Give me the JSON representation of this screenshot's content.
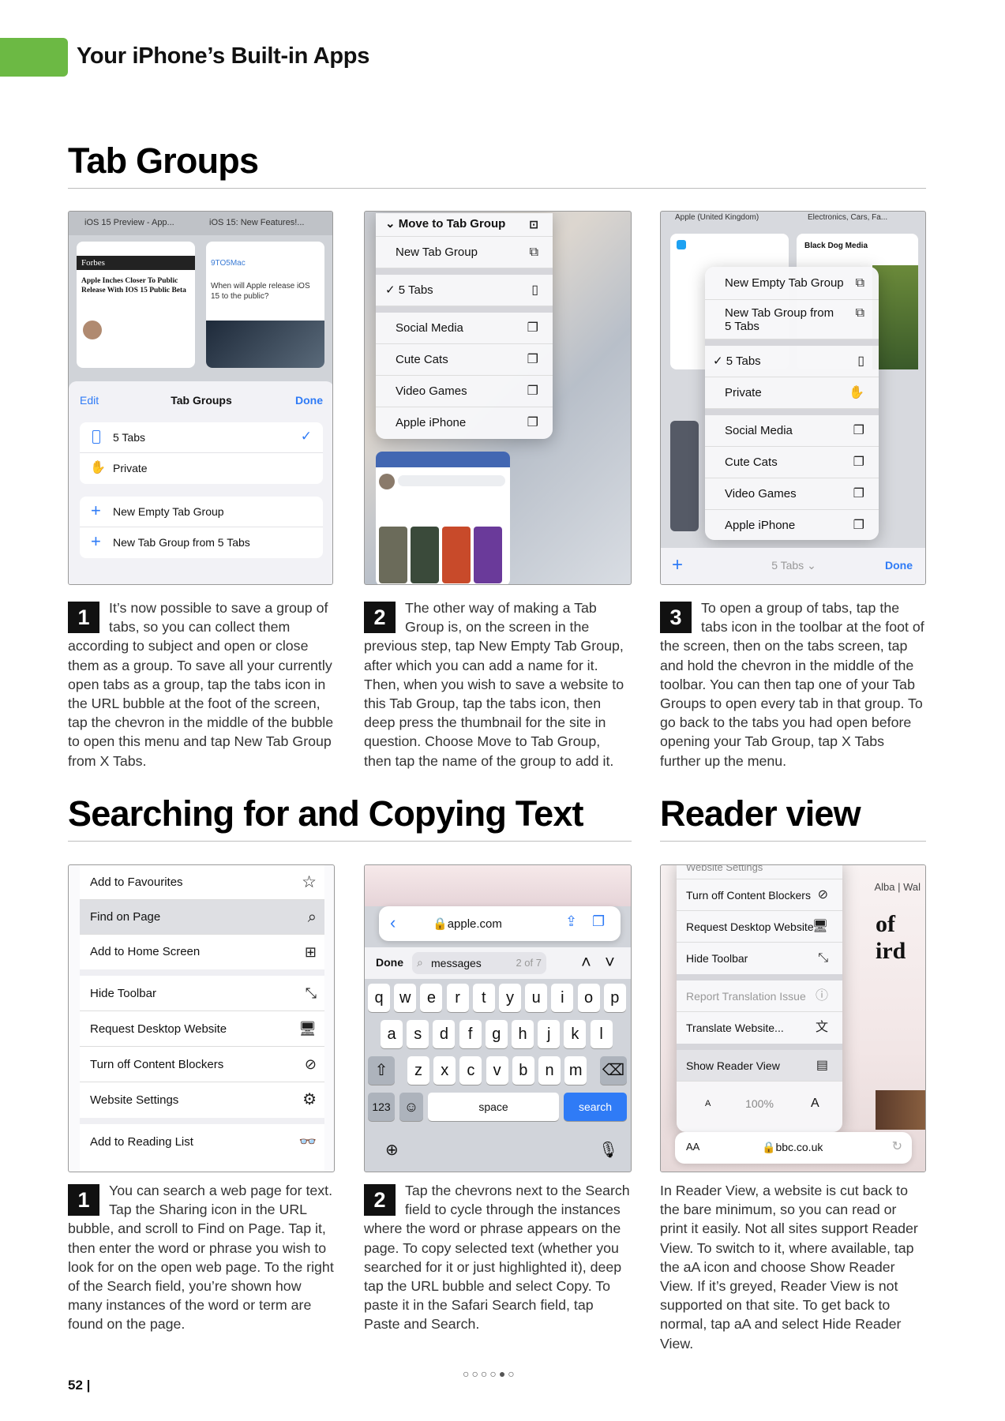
{
  "header": {
    "section": "Your iPhone’s Built-in Apps"
  },
  "sections": {
    "tab_groups": "Tab Groups",
    "searching": "Searching for and Copying Text",
    "reader": "Reader view"
  },
  "shot1": {
    "tab_left": "iOS 15 Preview - App...",
    "tab_right": "iOS 15: New Features!...",
    "card1_site": "Forbes",
    "card1_headline": "Apple Inches Closer To Public Release With IOS 15 Public Beta",
    "card2_site": "9TO5Mac",
    "card2_headline": "When will Apple release iOS 15 to the public?",
    "edit": "Edit",
    "title": "Tab Groups",
    "done": "Done",
    "rows": [
      "5 Tabs",
      "Private",
      "New Empty Tab Group",
      "New Tab Group from 5 Tabs"
    ]
  },
  "shot2": {
    "header": "Move to Tab Group",
    "rows": [
      "New Tab Group",
      "5 Tabs",
      "Social Media",
      "Cute Cats",
      "Video Games",
      "Apple iPhone"
    ]
  },
  "shot3": {
    "tab_left": "Apple (United Kingdom)",
    "tab_right": "Electronics, Cars, Fa...",
    "card_site": "Black Dog Media",
    "rows": [
      "New Empty Tab Group",
      "New Tab Group from 5 Tabs",
      "5 Tabs",
      "Private",
      "Social Media",
      "Cute Cats",
      "Video Games",
      "Apple iPhone"
    ],
    "toolbar_center": "5 Tabs",
    "toolbar_done": "Done"
  },
  "captions_top": [
    {
      "num": "1",
      "text": "It’s now possible to save a group of tabs, so you can collect them according to subject and open or close them as a group. To save all your currently open tabs as a group, tap the tabs icon in the URL bubble at the foot of the screen, tap the chevron in the middle of the bubble to open this menu and tap New Tab Group from X Tabs."
    },
    {
      "num": "2",
      "text": "The other way of making a Tab Group is, on the screen in the previous step, tap New Empty Tab Group, after which you can add a name for it. Then, when you wish to save a website to this Tab Group, tap the tabs icon, then deep press the thumbnail for the site in question. Choose Move to Tab Group, then tap the name of the group to add it."
    },
    {
      "num": "3",
      "text": "To open a group of tabs, tap the tabs icon in the toolbar at the foot of the screen, then on the tabs screen, tap and hold the chevron in the middle of the toolbar. You can then tap one of your Tab Groups to open every tab in that group. To go back to the tabs you had open before opening your Tab Group, tap X Tabs further up the menu."
    }
  ],
  "shot4": {
    "rows": [
      "Add to Favourites",
      "Find on Page",
      "Add to Home Screen",
      "Hide Toolbar",
      "Request Desktop Website",
      "Turn off Content Blockers",
      "Website Settings",
      "Add to Reading List"
    ]
  },
  "shot5": {
    "url": "apple.com",
    "done": "Done",
    "query": "messages",
    "count": "2 of 7",
    "row1": [
      "q",
      "w",
      "e",
      "r",
      "t",
      "y",
      "u",
      "i",
      "o",
      "p"
    ],
    "row2": [
      "a",
      "s",
      "d",
      "f",
      "g",
      "h",
      "j",
      "k",
      "l"
    ],
    "row3": [
      "z",
      "x",
      "c",
      "v",
      "b",
      "n",
      "m"
    ],
    "k123": "123",
    "space": "space",
    "search": "search"
  },
  "shot6": {
    "top_partial": "Website Settings",
    "rows": [
      "Turn off Content Blockers",
      "Request Desktop Website",
      "Hide Toolbar",
      "Report Translation Issue",
      "Translate Website...",
      "Show Reader View"
    ],
    "small_a": "A",
    "zoom": "100%",
    "big_a": "A",
    "aa": "AA",
    "url": "bbc.co.uk",
    "bg_right_tabs": "Alba | Wal",
    "bg_text1": "of",
    "bg_text2": "ird"
  },
  "captions_bottom": [
    {
      "num": "1",
      "text": "You can search a web page for text. Tap the Sharing icon in the URL bubble, and scroll to Find on Page. Tap it, then enter the word or phrase you wish to look for on the open web page. To the right of the Search field, you’re shown how many instances of the word or term are found on the page."
    },
    {
      "num": "2",
      "text": "Tap the chevrons next to the Search field to cycle through the instances where the word or phrase appears on the page. To copy selected text (whether you searched for it or just highlighted it), deep tap the URL bubble and select Copy. To paste it in the Safari Search field, tap Paste and Search."
    },
    {
      "num": "",
      "text": "In Reader View, a website is cut back to the bare minimum, so you can read or print it easily. Not all sites support Reader View. To switch to it, where available, tap the aA icon and choose Show Reader View. If it’s greyed, Reader View is not supported on that site. To get back to normal, tap aA and select Hide Reader View."
    }
  ],
  "footer": {
    "page": "52 |",
    "pager": "○○○○●○"
  }
}
